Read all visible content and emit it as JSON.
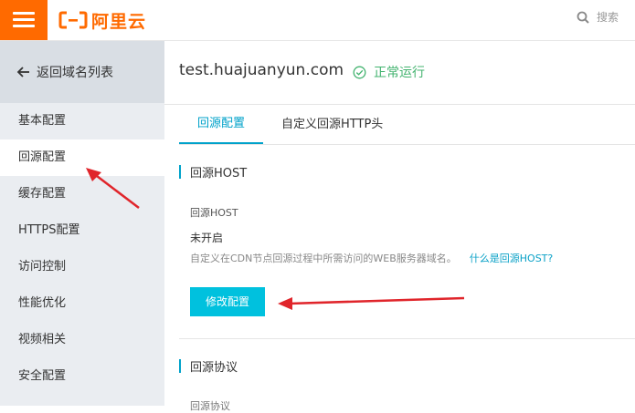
{
  "header": {
    "logo_text": "阿里云",
    "search_placeholder": "搜索"
  },
  "sidebar": {
    "back_label": "返回域名列表",
    "items": [
      {
        "label": "基本配置",
        "active": false
      },
      {
        "label": "回源配置",
        "active": true
      },
      {
        "label": "缓存配置",
        "active": false
      },
      {
        "label": "HTTPS配置",
        "active": false
      },
      {
        "label": "访问控制",
        "active": false
      },
      {
        "label": "性能优化",
        "active": false
      },
      {
        "label": "视频相关",
        "active": false
      },
      {
        "label": "安全配置",
        "active": false
      }
    ]
  },
  "main": {
    "domain": "test.huajuanyun.com",
    "status": "正常运行",
    "tabs": [
      {
        "label": "回源配置",
        "active": true
      },
      {
        "label": "自定义回源HTTP头",
        "active": false
      }
    ],
    "section_host": {
      "title": "回源HOST",
      "field_label": "回源HOST",
      "field_value": "未开启",
      "help_text": "自定义在CDN节点回源过程中所需访问的WEB服务器域名。",
      "help_link": "什么是回源HOST?",
      "edit_button": "修改配置"
    },
    "section_protocol": {
      "title": "回源协议",
      "field_label": "回源协议"
    }
  },
  "colors": {
    "brand": "#ff6a00",
    "accent": "#00a2ca",
    "button": "#00c1de",
    "status_ok": "#43b36f",
    "annotation": "#e0252b"
  }
}
